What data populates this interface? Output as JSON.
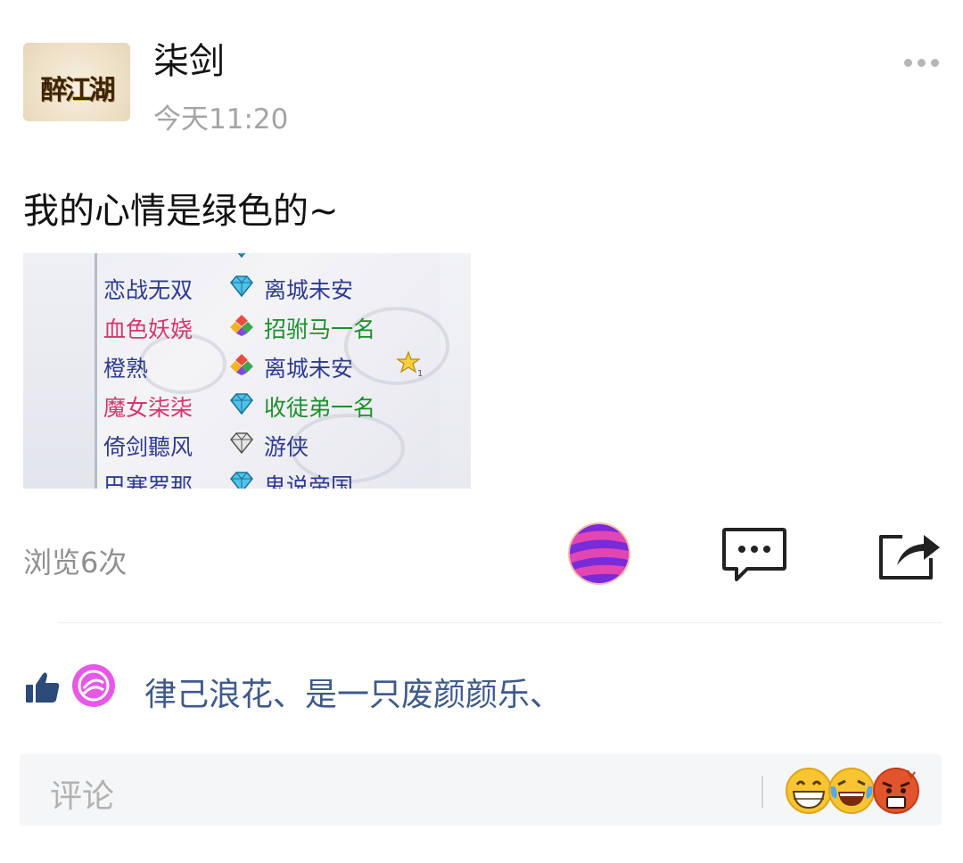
{
  "post": {
    "username": "柒剑",
    "time": "今天11:20",
    "avatar_logo_text": "醉江湖",
    "text": "我的心情是绿色的~",
    "image_rows": [
      {
        "name": "",
        "title": "",
        "name_color": "#3b3f8f",
        "title_color": "#3b3f8f",
        "gem": "blue",
        "star": false
      },
      {
        "name": "恋战无双",
        "title": "离城未安",
        "name_color": "#2f3b8f",
        "title_color": "#2f3b8f",
        "gem": "blue",
        "star": false
      },
      {
        "name": "血色妖娆",
        "title": "招驸马一名",
        "name_color": "#d6366e",
        "title_color": "#1c8f2d",
        "gem": "multi",
        "star": false
      },
      {
        "name": "橙熟",
        "title": "离城未安",
        "name_color": "#2f3b8f",
        "title_color": "#2f3b8f",
        "gem": "multi",
        "star": true
      },
      {
        "name": "魔女柒柒",
        "title": "收徒弟一名",
        "name_color": "#d6366e",
        "title_color": "#1c8f2d",
        "gem": "blue",
        "star": false
      },
      {
        "name": "倚剑聽风",
        "title": "游侠",
        "name_color": "#2f3b8f",
        "title_color": "#2f3b8f",
        "gem": "gray",
        "star": false
      },
      {
        "name": "巴塞罗那",
        "title": "鬼说帝国",
        "name_color": "#2f3b8f",
        "title_color": "#2f3b8f",
        "gem": "blue",
        "star": false
      }
    ],
    "star_count": "1",
    "views": "浏览6次",
    "likers": "律己浪花、是一只废颜颜乐、"
  },
  "icons": {
    "more": "more-dots-icon",
    "planet": "planet-avatar-icon",
    "comment": "comment-bubble-icon",
    "share": "share-arrow-icon",
    "like": "thumbs-up-icon"
  },
  "comment_bar": {
    "placeholder": "评论",
    "emojis": [
      "grin-emoji",
      "laugh-cry-emoji",
      "angry-emoji"
    ]
  },
  "colors": {
    "username": "#111111",
    "meta_gray": "#a4a4a4",
    "link_blue": "#3f5a8a",
    "comment_bar_bg": "#f5f6f8"
  }
}
